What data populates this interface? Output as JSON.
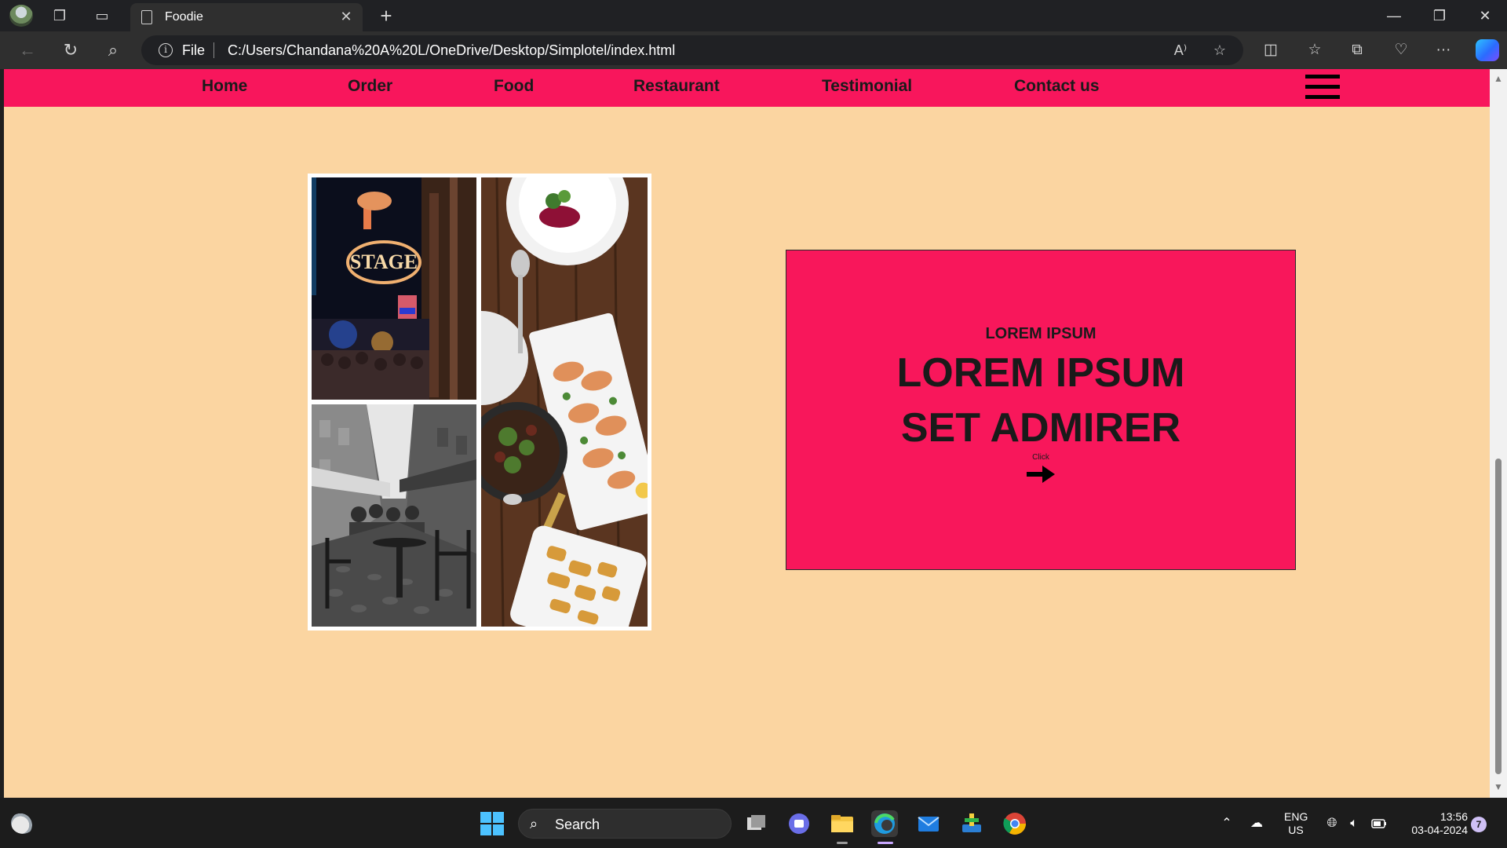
{
  "browser": {
    "tab_title": "Foodie",
    "address_scheme": "File",
    "address_url": "C:/Users/Chandana%20A%20L/OneDrive/Desktop/Simplotel/index.html"
  },
  "site": {
    "nav": [
      "Home",
      "Order",
      "Food",
      "Restaurant",
      "Testimonial",
      "Contact us"
    ],
    "hero": {
      "kicker": "LOREM IPSUM",
      "headline_line1": "LOREM IPSUM",
      "headline_line2": "SET ADMIRER",
      "cta_label": "Click"
    },
    "colors": {
      "nav_bg": "#f8165c",
      "page_bg": "#fbd5a1",
      "card_bg": "#f8175b"
    }
  },
  "taskbar": {
    "search_label": "Search",
    "language": "ENG",
    "region": "US",
    "time": "13:56",
    "date": "03-04-2024",
    "notification_count": "7"
  },
  "scroll_position": 0.62
}
